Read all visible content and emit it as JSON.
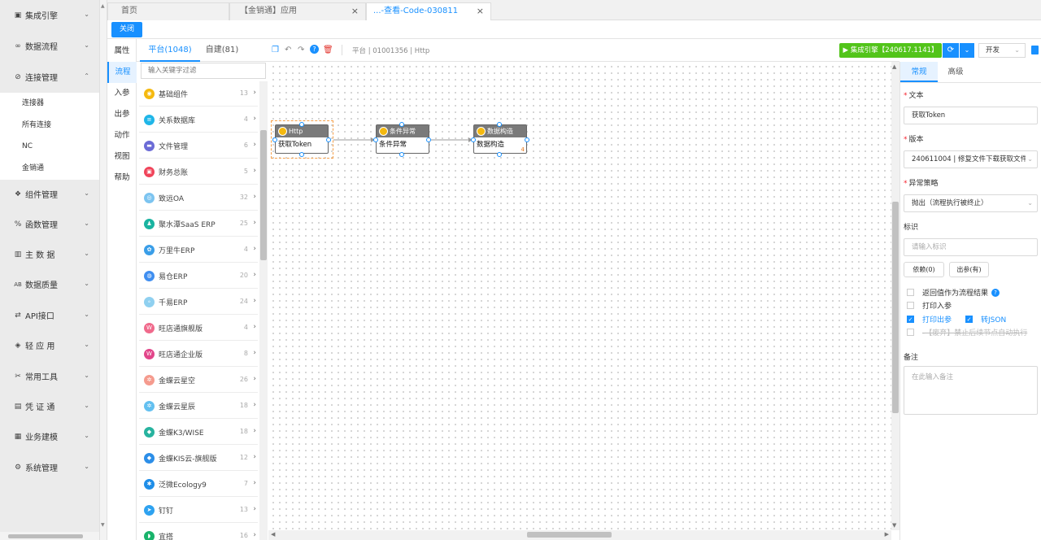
{
  "sidebar": {
    "items": [
      {
        "icon": "▣",
        "icon_name": "monitor-icon",
        "label": "集成引擎"
      },
      {
        "icon": "∞",
        "icon_name": "infinity-icon",
        "label": "数据流程"
      },
      {
        "icon": "🔗",
        "icon_name": "link-icon",
        "label": "连接管理",
        "expanded": true
      },
      {
        "icon": "❖",
        "icon_name": "components-icon",
        "label": "组件管理"
      },
      {
        "icon": "%",
        "icon_name": "function-icon",
        "label": "函数管理"
      },
      {
        "icon": "▥",
        "icon_name": "map-icon",
        "label": "主 数 据"
      },
      {
        "icon": "AB",
        "icon_name": "quality-icon",
        "label": "数据质量"
      },
      {
        "icon": "⇄",
        "icon_name": "api-icon",
        "label": "API接口"
      },
      {
        "icon": "◈",
        "icon_name": "cube-icon",
        "label": "轻 应 用"
      },
      {
        "icon": "✂",
        "icon_name": "tools-icon",
        "label": "常用工具"
      },
      {
        "icon": "▤",
        "icon_name": "voucher-icon",
        "label": "凭 证 通"
      },
      {
        "icon": "▦",
        "icon_name": "grid-icon",
        "label": "业务建模"
      },
      {
        "icon": "⚙",
        "icon_name": "gear-icon",
        "label": "系统管理"
      }
    ],
    "subitems": [
      "连接器",
      "所有连接",
      "NC",
      "金销通"
    ]
  },
  "tabs": [
    {
      "label": "首页"
    },
    {
      "label": "【金销通】应用",
      "close": "×"
    },
    {
      "label": "...-查看-Code-030811",
      "close": "×"
    }
  ],
  "toolbar": {
    "close_label": "关闭"
  },
  "left_tabs": [
    "属性",
    "流程",
    "入参",
    "出参",
    "动作",
    "视图",
    "帮助"
  ],
  "tree": {
    "tab_platform": "平台(1048)",
    "tab_custom": "自建(81)",
    "filter_placeholder": "输入关键字过滤",
    "rows": [
      {
        "label": "基础组件",
        "count": "13",
        "color": "#f5b90f",
        "glyph": "◉"
      },
      {
        "label": "关系数据库",
        "count": "4",
        "color": "#1fb6e8",
        "glyph": "≡"
      },
      {
        "label": "文件管理",
        "count": "6",
        "color": "#6b6bd6",
        "glyph": "▬"
      },
      {
        "label": "财务总账",
        "count": "5",
        "color": "#f0445a",
        "glyph": "▣"
      },
      {
        "label": "致远OA",
        "count": "32",
        "color": "#7cc4f0",
        "glyph": "◎"
      },
      {
        "label": "聚水潭SaaS ERP",
        "count": "25",
        "color": "#19b3a0",
        "glyph": "♟"
      },
      {
        "label": "万里牛ERP",
        "count": "4",
        "color": "#3a9ee8",
        "glyph": "✿"
      },
      {
        "label": "易仓ERP",
        "count": "20",
        "color": "#3f8ef0",
        "glyph": "◍"
      },
      {
        "label": "千易ERP",
        "count": "24",
        "color": "#8fd0f0",
        "glyph": "∘"
      },
      {
        "label": "旺店通旗舰版",
        "count": "4",
        "color": "#f06a8c",
        "glyph": "W"
      },
      {
        "label": "旺店通企业版",
        "count": "8",
        "color": "#e2458a",
        "glyph": "W"
      },
      {
        "label": "金蝶云星空",
        "count": "26",
        "color": "#f59b8e",
        "glyph": "✲"
      },
      {
        "label": "金蝶云星辰",
        "count": "18",
        "color": "#63c0f0",
        "glyph": "✲"
      },
      {
        "label": "金蝶K3/WISE",
        "count": "18",
        "color": "#27b39f",
        "glyph": "◆"
      },
      {
        "label": "金蝶KIS云-旗舰版",
        "count": "12",
        "color": "#2c8ee8",
        "glyph": "◆"
      },
      {
        "label": "泛微Ecology9",
        "count": "7",
        "color": "#1f8ee8",
        "glyph": "✱"
      },
      {
        "label": "钉钉",
        "count": "13",
        "color": "#2ea2f0",
        "glyph": "➤"
      },
      {
        "label": "宜搭",
        "count": "16",
        "color": "#19b36b",
        "glyph": "◗"
      }
    ]
  },
  "canvas_toolbar": {
    "breadcrumb": "平台 | 01001356 | Http",
    "run_label": "▶ 集成引擎【240617.1141】",
    "env_value": "开发"
  },
  "nodes": [
    {
      "title": "Http",
      "body": "获取Token"
    },
    {
      "title": "条件异常",
      "body": "条件异常"
    },
    {
      "title": "数据构造",
      "body": "数据构造",
      "mark": "4"
    }
  ],
  "props": {
    "tab_general": "常规",
    "tab_advanced": "高级",
    "text_label": "文本",
    "text_value": "获取Token",
    "version_label": "版本",
    "version_value": "240611004 | 修复文件下载获取文件",
    "error_label": "异常策略",
    "error_value": "抛出（流程执行被终止）",
    "id_label": "标识",
    "id_placeholder": "请输入标识",
    "deps_btn": "依赖(0)",
    "out_btn": "出参(有)",
    "cb_return": "返回值作为流程结果",
    "cb_print_in": "打印入参",
    "cb_print_out": "打印出参",
    "cb_json": "转JSON",
    "cb_disabled": "-【废弃】禁止后续节点自动执行",
    "remark_label": "备注",
    "remark_placeholder": "在此输入备注"
  },
  "colors": {
    "accent": "#1890ff",
    "run": "#52c41a",
    "node_header": "#7a7a7a"
  }
}
